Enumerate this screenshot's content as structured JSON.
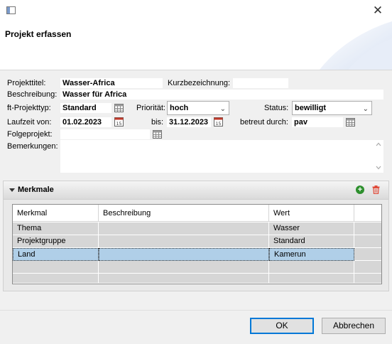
{
  "window": {
    "close_glyph": "✕"
  },
  "header": {
    "title": "Projekt erfassen"
  },
  "form": {
    "projekttitel_label": "Projekttitel:",
    "projekttitel_value": "Wasser-Africa",
    "kurzbezeichnung_label": "Kurzbezeichnung:",
    "kurzbezeichnung_value": "",
    "beschreibung_label": "Beschreibung:",
    "beschreibung_value": "Wasser für Africa",
    "projekttyp_label": "ft-Projekttyp:",
    "projekttyp_value": "Standard",
    "prioritaet_label": "Priorität:",
    "prioritaet_value": "hoch",
    "status_label": "Status:",
    "status_value": "bewilligt",
    "laufzeit_label": "Laufzeit von:",
    "laufzeit_von": "01.02.2023",
    "bis_label": "bis:",
    "laufzeit_bis": "31.12.2023",
    "betreut_label": "betreut durch:",
    "betreut_value": "pav",
    "folgeprojekt_label": "Folgeprojekt:",
    "folgeprojekt_value": "",
    "bemerkungen_label": "Bemerkungen:",
    "bemerkungen_value": ""
  },
  "merkmale": {
    "title": "Merkmale",
    "columns": [
      "Merkmal",
      "Beschreibung",
      "Wert"
    ],
    "rows": [
      {
        "merkmal": "Thema",
        "beschreibung": "",
        "wert": "Wasser"
      },
      {
        "merkmal": "Projektgruppe",
        "beschreibung": "",
        "wert": "Standard"
      },
      {
        "merkmal": "Land",
        "beschreibung": "",
        "wert": "Kamerun"
      }
    ]
  },
  "buttons": {
    "ok": "OK",
    "cancel": "Abbrechen"
  },
  "colors": {
    "selected_row": "#b0cfe8",
    "row": "#d6d6d6",
    "add": "#2d8f2d",
    "delete": "#e04b3a"
  }
}
